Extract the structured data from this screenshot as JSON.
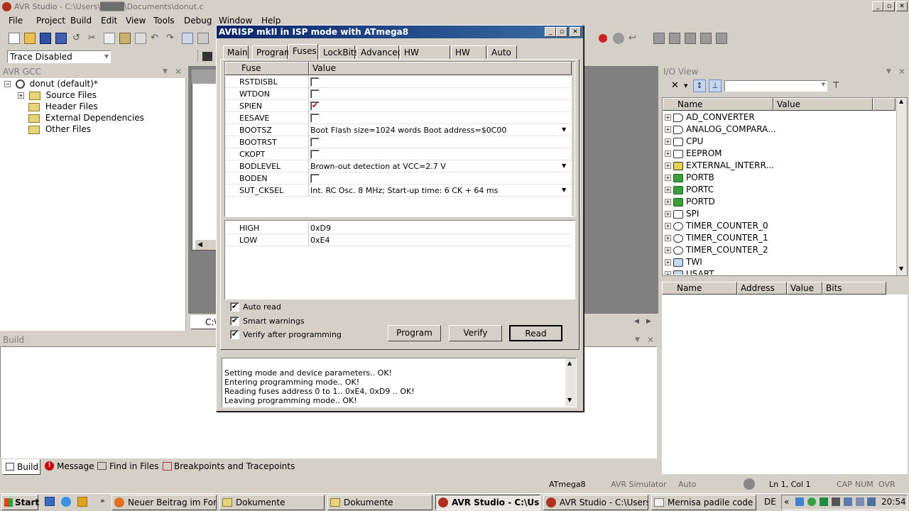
{
  "window": {
    "title": "AVR Studio - C:\\Users\\████\\Documents\\donut.c"
  },
  "menu": [
    "File",
    "Project",
    "Build",
    "Edit",
    "View",
    "Tools",
    "Debug",
    "Window",
    "Help"
  ],
  "trace": {
    "value": "Trace Disabled"
  },
  "avrgcc": {
    "title": "AVR GCC",
    "project": "donut (default)*",
    "folders": [
      "Source Files",
      "Header Files",
      "External Dependencies",
      "Other Files"
    ]
  },
  "editor": {
    "tab_label": "C:\\"
  },
  "dialog": {
    "title": "AVRISP mkII in ISP mode with ATmega8",
    "tabs": [
      "Main",
      "Program",
      "Fuses",
      "LockBits",
      "Advanced",
      "HW Settings",
      "HW Info",
      "Auto"
    ],
    "active_tab": "Fuses",
    "columns": {
      "fuse": "Fuse",
      "value": "Value"
    },
    "fuses": [
      {
        "name": "RSTDISBL",
        "type": "check",
        "checked": false
      },
      {
        "name": "WTDON",
        "type": "check",
        "checked": false
      },
      {
        "name": "SPIEN",
        "type": "check",
        "checked": true
      },
      {
        "name": "EESAVE",
        "type": "check",
        "checked": false
      },
      {
        "name": "BOOTSZ",
        "type": "select",
        "value": "Boot Flash size=1024 words Boot address=$0C00"
      },
      {
        "name": "BOOTRST",
        "type": "check",
        "checked": false
      },
      {
        "name": "CKOPT",
        "type": "check",
        "checked": false
      },
      {
        "name": "BODLEVEL",
        "type": "select",
        "value": "Brown-out detection at VCC=2.7 V"
      },
      {
        "name": "BODEN",
        "type": "check",
        "checked": false
      },
      {
        "name": "SUT_CKSEL",
        "type": "select",
        "value": "Int. RC Osc. 8 MHz; Start-up time: 6 CK + 64 ms"
      }
    ],
    "bytes": [
      {
        "name": "HIGH",
        "value": "0xD9"
      },
      {
        "name": "LOW",
        "value": "0xE4"
      }
    ],
    "options": [
      {
        "label": "Auto read",
        "checked": true
      },
      {
        "label": "Smart warnings",
        "checked": true
      },
      {
        "label": "Verify after programming",
        "checked": true
      }
    ],
    "buttons": {
      "program": "Program",
      "verify": "Verify",
      "read": "Read"
    },
    "log": [
      "Setting mode and device parameters.. OK!",
      "Entering programming mode.. OK!",
      "Reading fuses address 0 to 1.. 0xE4, 0xD9 .. OK!",
      "Leaving programming mode.. OK!"
    ]
  },
  "ioview": {
    "title": "I/O View",
    "columns": {
      "name": "Name",
      "value": "Value"
    },
    "items": [
      "AD_CONVERTER",
      "ANALOG_COMPARA...",
      "CPU",
      "EEPROM",
      "EXTERNAL_INTERR...",
      "PORTB",
      "PORTC",
      "PORTD",
      "SPI",
      "TIMER_COUNTER_0",
      "TIMER_COUNTER_1",
      "TIMER_COUNTER_2",
      "TWI",
      "USART"
    ],
    "detail_columns": [
      "Name",
      "Address",
      "Value",
      "Bits"
    ]
  },
  "build": {
    "title": "Build",
    "tabs": [
      "Build",
      "Message",
      "Find in Files",
      "Breakpoints and Tracepoints"
    ]
  },
  "status": {
    "device": "ATmega8",
    "platform": "AVR Simulator",
    "mode": "Auto",
    "position": "Ln 1, Col 1",
    "caps": "CAP",
    "num": "NUM",
    "ovr": "OVR"
  },
  "taskbar": {
    "start": "Start",
    "tasks": [
      "Neuer Beitrag im Foru...",
      "Dokumente",
      "Dokumente",
      "AVR Studio - C:\\Use...",
      "AVR Studio - C:\\Users\\...",
      "Mernisa padile code <..."
    ],
    "active_task": 3,
    "lang": "DE",
    "clock": "20:54"
  },
  "colors": {
    "accent": "#0a246a",
    "check": "#c00000"
  }
}
